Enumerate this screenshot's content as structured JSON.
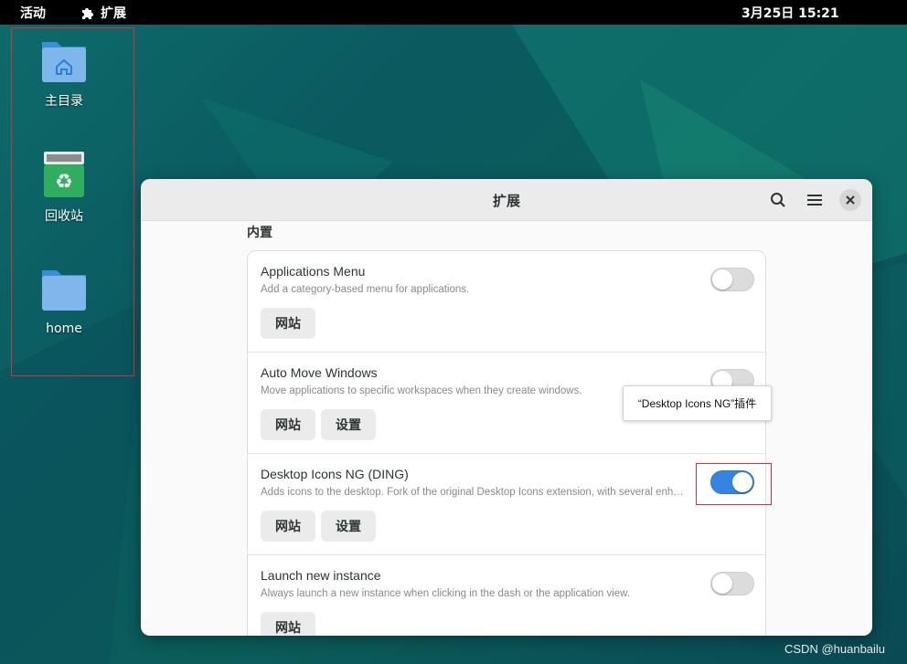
{
  "topbar": {
    "activities": "活动",
    "app_name": "扩展",
    "clock": "3月25日  15:21"
  },
  "desktop": {
    "icons": [
      {
        "label": "主目录",
        "icon": "home-folder-icon"
      },
      {
        "label": "回收站",
        "icon": "trash-icon"
      },
      {
        "label": "home",
        "icon": "folder-icon"
      }
    ]
  },
  "window": {
    "title": "扩展",
    "section_title": "内置",
    "extensions": [
      {
        "name": "Applications Menu",
        "description": "Add a category-based menu for applications.",
        "enabled": false,
        "buttons": [
          "网站"
        ]
      },
      {
        "name": "Auto Move Windows",
        "description": "Move applications to specific workspaces when they create windows.",
        "enabled": false,
        "buttons": [
          "网站",
          "设置"
        ]
      },
      {
        "name": "Desktop Icons NG (DING)",
        "description": "Adds icons to the desktop. Fork of the original Desktop Icons extension, with several enh…",
        "enabled": true,
        "buttons": [
          "网站",
          "设置"
        ]
      },
      {
        "name": "Launch new instance",
        "description": "Always launch a new instance when clicking in the dash or the application view.",
        "enabled": false,
        "buttons": [
          "网站"
        ]
      }
    ]
  },
  "tooltip": "“Desktop Icons NG”插件",
  "watermark": "CSDN @huanbailu",
  "colors": {
    "accent": "#3584e4",
    "highlight": "#d0343a"
  }
}
